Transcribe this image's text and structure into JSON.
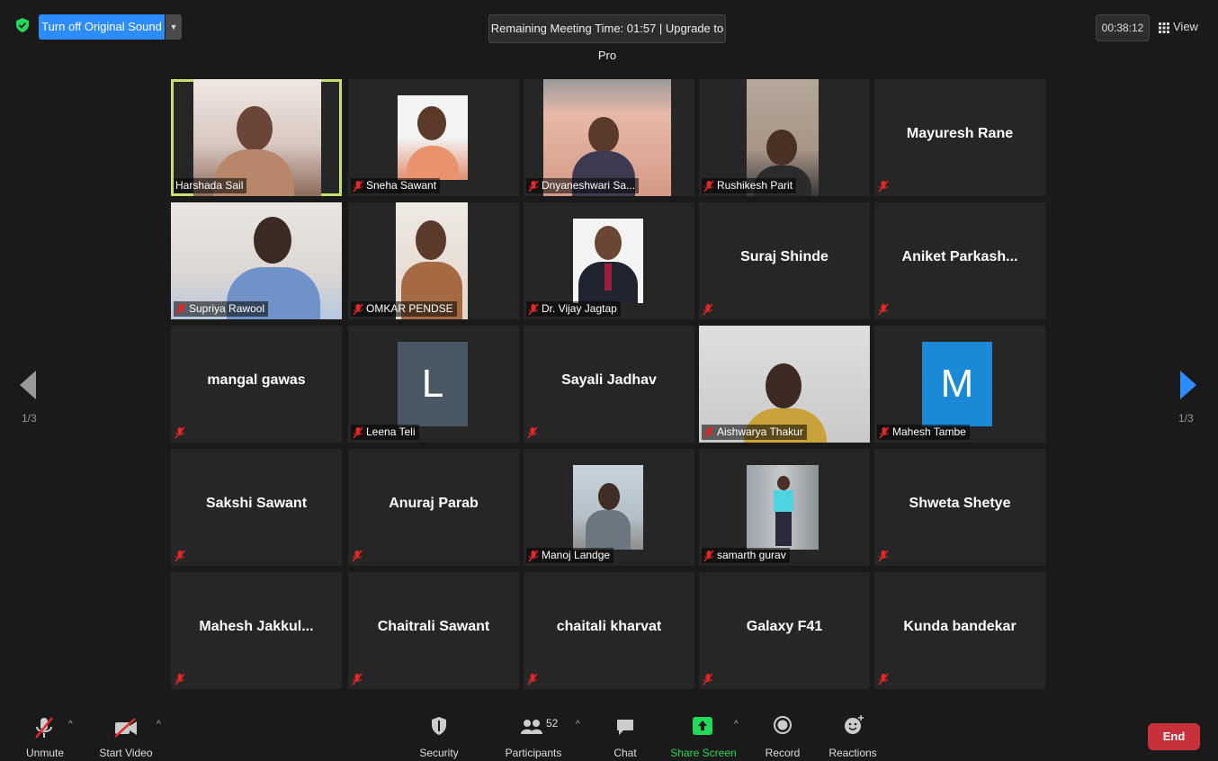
{
  "topbar": {
    "original_sound": "Turn off Original Sound",
    "meeting_time": "Remaining Meeting Time: 01:57 | Upgrade to Pro",
    "timer": "00:38:12",
    "view": "View"
  },
  "gallery": {
    "page_left": "1/3",
    "page_right": "1/3",
    "tiles": [
      {
        "name": "Harshada Sail"
      },
      {
        "name": "Sneha Sawant"
      },
      {
        "name": "Dnyaneshwari Sa..."
      },
      {
        "name": "Rushikesh Parit"
      },
      {
        "name": "Mayuresh Rane"
      },
      {
        "name": "Supriya Rawool"
      },
      {
        "name": "OMKAR PENDSE"
      },
      {
        "name": "Dr. Vijay Jagtap"
      },
      {
        "name": "Suraj Shinde"
      },
      {
        "name": "Aniket  Parkash..."
      },
      {
        "name": "mangal gawas"
      },
      {
        "name": "Leena Teli",
        "avatar": "L"
      },
      {
        "name": "Sayali Jadhav"
      },
      {
        "name": "Aishwarya Thakur"
      },
      {
        "name": "Mahesh Tambe",
        "avatar": "M"
      },
      {
        "name": "Sakshi Sawant"
      },
      {
        "name": "Anuraj Parab"
      },
      {
        "name": "Manoj Landge"
      },
      {
        "name": "samarth gurav"
      },
      {
        "name": "Shweta Shetye"
      },
      {
        "name": "Mahesh  Jakkul..."
      },
      {
        "name": "Chaitrali Sawant"
      },
      {
        "name": "chaitali kharvat"
      },
      {
        "name": "Galaxy F41"
      },
      {
        "name": "Kunda  bandekar"
      }
    ]
  },
  "toolbar": {
    "unmute": "Unmute",
    "start_video": "Start Video",
    "security": "Security",
    "participants": "Participants",
    "participants_count": "52",
    "chat": "Chat",
    "share_screen": "Share Screen",
    "record": "Record",
    "reactions": "Reactions",
    "end": "End"
  },
  "colors": {
    "accent": "#2d8cff",
    "active_speaker": "#c6e06b",
    "share": "#23d959",
    "end": "#c8313a",
    "mute": "#e02828"
  }
}
